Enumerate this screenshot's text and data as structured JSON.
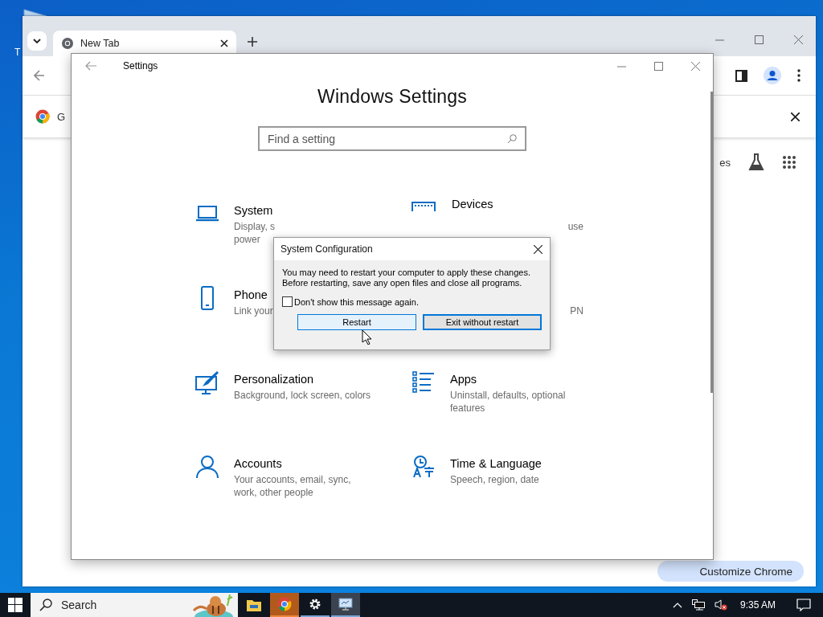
{
  "desktop": {
    "icon_label": "T"
  },
  "browser": {
    "tab": {
      "title": "New Tab",
      "selected": true
    },
    "infobar": {
      "text": "G"
    },
    "content": {
      "partial_text": "es"
    },
    "customize_button": "Customize Chrome"
  },
  "settings": {
    "title": "Settings",
    "heading": "Windows Settings",
    "search": {
      "placeholder": "Find a setting"
    },
    "tiles": [
      {
        "kind": "full",
        "title": "System",
        "desc": [
          "Display, s",
          "power"
        ]
      },
      {
        "kind": "covered",
        "title": "Devices",
        "desc": [
          "use"
        ]
      },
      {
        "kind": "full",
        "title": "Phone",
        "desc": [
          "Link your"
        ]
      },
      {
        "kind": "covered",
        "desc": [
          "PN"
        ]
      },
      {
        "kind": "full",
        "title": "Personalization",
        "desc": [
          "Background, lock screen, colors"
        ]
      },
      {
        "kind": "full",
        "title": "Apps",
        "desc": [
          "Uninstall, defaults, optional",
          "features"
        ]
      },
      {
        "kind": "full",
        "title": "Accounts",
        "desc": [
          "Your accounts, email, sync,",
          "work, other people"
        ]
      },
      {
        "kind": "full",
        "title": "Time & Language",
        "desc": [
          "Speech, region, date"
        ]
      }
    ]
  },
  "dialog": {
    "title": "System Configuration",
    "message": [
      "You may need to restart your computer to apply these changes.",
      "Before restarting, save any open files and close all programs."
    ],
    "checkbox": {
      "label": "Don't show this message again.",
      "checked": false
    },
    "buttons": [
      {
        "label": "Restart",
        "hovered": true,
        "focused": false
      },
      {
        "label": "Exit without restart",
        "hovered": false,
        "focused": true
      }
    ]
  },
  "taskbar": {
    "search": {
      "placeholder": "Search"
    },
    "apps": [
      {
        "open": false,
        "selected": false,
        "flashing": false
      },
      {
        "open": true,
        "selected": false,
        "flashing": true
      },
      {
        "open": true,
        "selected": false,
        "flashing": false
      },
      {
        "open": true,
        "selected": true,
        "flashing": false
      }
    ],
    "volume_muted": true,
    "time": "9:35 AM"
  }
}
